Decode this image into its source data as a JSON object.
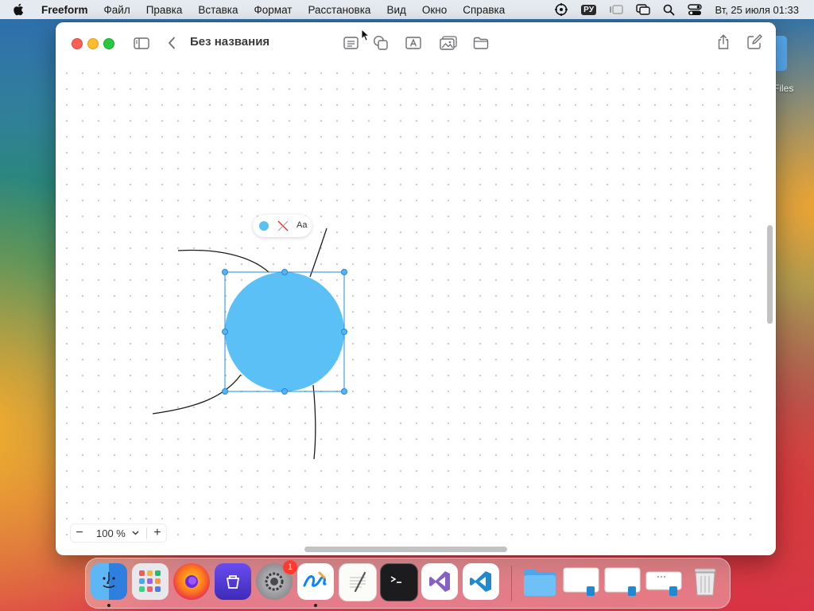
{
  "menubar": {
    "apple": "apple-icon",
    "items": [
      "Freeform",
      "Файл",
      "Правка",
      "Вставка",
      "Формат",
      "Расстановка",
      "Вид",
      "Окно",
      "Справка"
    ],
    "input_source": "РУ",
    "datetime": "Вт, 25 июля  01:33"
  },
  "desktop": {
    "side_item_label": "Files"
  },
  "window": {
    "title": "Без названия",
    "zoom": {
      "value": "100 %",
      "minus": "−",
      "plus": "+"
    }
  },
  "selection_popover": {
    "fill_color": "#5ac0f6",
    "text_label": "Aa"
  },
  "canvas": {
    "shape": {
      "type": "circle",
      "fill": "#5ac0f6",
      "selected": true
    },
    "connectors": 4
  },
  "dock": {
    "apps": [
      {
        "name": "Finder",
        "running": true
      },
      {
        "name": "Launchpad"
      },
      {
        "name": "Firefox"
      },
      {
        "name": "App"
      },
      {
        "name": "System Settings",
        "badge": "1"
      },
      {
        "name": "Freeform",
        "running": true
      },
      {
        "name": "TextEdit"
      },
      {
        "name": "Terminal"
      },
      {
        "name": "Visual Studio"
      },
      {
        "name": "Visual Studio Code"
      }
    ],
    "others": [
      "Downloads folder",
      "window",
      "window",
      "window",
      "Trash"
    ]
  },
  "colors": {
    "accent": "#5ac0f6",
    "selection": "#1e88e5"
  }
}
